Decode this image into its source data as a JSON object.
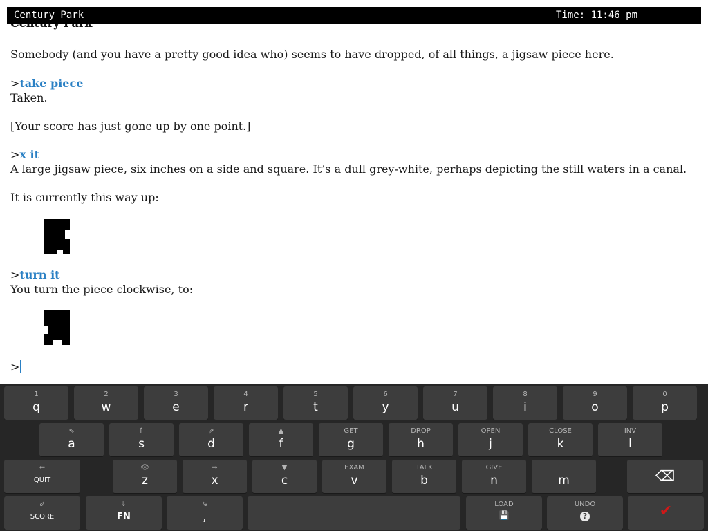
{
  "status": {
    "location": "Century Park",
    "time": "Time: 11:46 pm"
  },
  "transcript": {
    "cut_title": "Century Park",
    "p1": "Somebody (and you have a pretty good idea who) seems to have dropped, of all things, a jigsaw piece here.",
    "prompt": ">",
    "cmd1": "take piece",
    "r1": "Taken.",
    "score": "[Your score has just gone up by one point.]",
    "cmd2": "x it",
    "r2": "A large jigsaw piece, six inches on a side and square. It’s a dull grey-white, perhaps depicting the still waters in a canal.",
    "r3": "It is currently this way up:",
    "cmd3": "turn it",
    "r4": "You turn the piece clockwise, to:",
    "input_prompt": ">"
  },
  "keyboard": {
    "row1": [
      {
        "hint": "1",
        "label": "q"
      },
      {
        "hint": "2",
        "label": "w"
      },
      {
        "hint": "3",
        "label": "e"
      },
      {
        "hint": "4",
        "label": "r"
      },
      {
        "hint": "5",
        "label": "t"
      },
      {
        "hint": "6",
        "label": "y"
      },
      {
        "hint": "7",
        "label": "u"
      },
      {
        "hint": "8",
        "label": "i"
      },
      {
        "hint": "9",
        "label": "o"
      },
      {
        "hint": "0",
        "label": "p"
      }
    ],
    "row2": [
      {
        "hint": "⇖",
        "label": "a"
      },
      {
        "hint": "⇑",
        "label": "s"
      },
      {
        "hint": "⇗",
        "label": "d"
      },
      {
        "hint": "▲",
        "label": "f"
      },
      {
        "hint": "GET",
        "label": "g"
      },
      {
        "hint": "DROP",
        "label": "h"
      },
      {
        "hint": "OPEN",
        "label": "j"
      },
      {
        "hint": "CLOSE",
        "label": "k"
      },
      {
        "hint": "INV",
        "label": "l"
      }
    ],
    "row3": [
      {
        "hint": "⇐",
        "label": "QUIT"
      },
      {
        "hint": "👁",
        "label": "z"
      },
      {
        "hint": "⇒",
        "label": "x"
      },
      {
        "hint": "▼",
        "label": "c"
      },
      {
        "hint": "EXAM",
        "label": "v"
      },
      {
        "hint": "TALK",
        "label": "b"
      },
      {
        "hint": "GIVE",
        "label": "n"
      },
      {
        "hint": "",
        "label": "m"
      },
      {
        "hint": "",
        "label": "⌫"
      }
    ],
    "row4": [
      {
        "hint": "⇙",
        "label": "SCORE"
      },
      {
        "hint": "⇓",
        "label": "FN"
      },
      {
        "hint": "⇘",
        "label": ","
      },
      {
        "hint": "",
        "label": ""
      },
      {
        "hint": "LOAD",
        "label": "💾"
      },
      {
        "hint": "UNDO",
        "label": "?"
      },
      {
        "hint": "",
        "label": "✔"
      }
    ]
  },
  "colors": {
    "command": "#2a80c4",
    "keyboard_bg": "#262626",
    "key_bg": "#3d3d3d",
    "enter_check": "#d01818"
  }
}
